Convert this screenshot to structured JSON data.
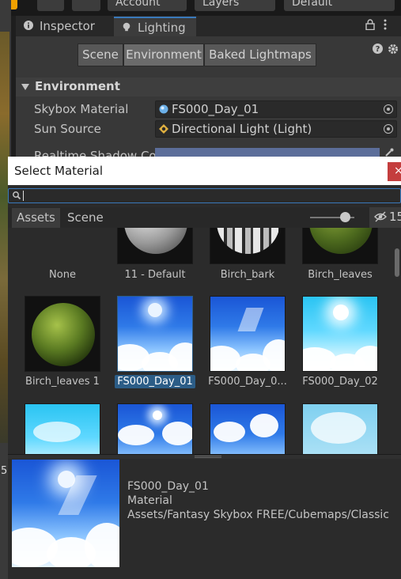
{
  "topbar": {
    "account_label": "Account",
    "layers_label": "Layers",
    "layout_label": "Default"
  },
  "tabs": [
    {
      "label": "Inspector"
    },
    {
      "label": "Lighting"
    }
  ],
  "lighting_modes": [
    "Scene",
    "Environment",
    "Baked Lightmaps"
  ],
  "environment": {
    "section_title": "Environment",
    "skybox_label": "Skybox Material",
    "skybox_value": "FS000_Day_01",
    "sun_label": "Sun Source",
    "sun_value": "Directional Light (Light)",
    "shadow_label": "Realtime Shadow Co"
  },
  "left_strip": {
    "number": "5"
  },
  "dialog": {
    "title": "Select Material",
    "close_label": "×",
    "search_value": "",
    "tabs": [
      "Assets",
      "Scene"
    ],
    "hidden_count": "15",
    "thumbnail_size_fraction": 0.8,
    "items": [
      {
        "label": "None"
      },
      {
        "label": "11 - Default"
      },
      {
        "label": "Birch_bark"
      },
      {
        "label": "Birch_leaves"
      },
      {
        "label": "Birch_leaves 1"
      },
      {
        "label": "FS000_Day_01"
      },
      {
        "label": "FS000_Day_0..."
      },
      {
        "label": "FS000_Day_02"
      }
    ],
    "selected": {
      "name": "FS000_Day_01",
      "type": "Material",
      "path": "Assets/Fantasy Skybox FREE/Cubemaps/Classic"
    }
  },
  "colors": {
    "accent": "#3a79bb",
    "selection": "#2c5d87",
    "close_red": "#c43e3e"
  }
}
